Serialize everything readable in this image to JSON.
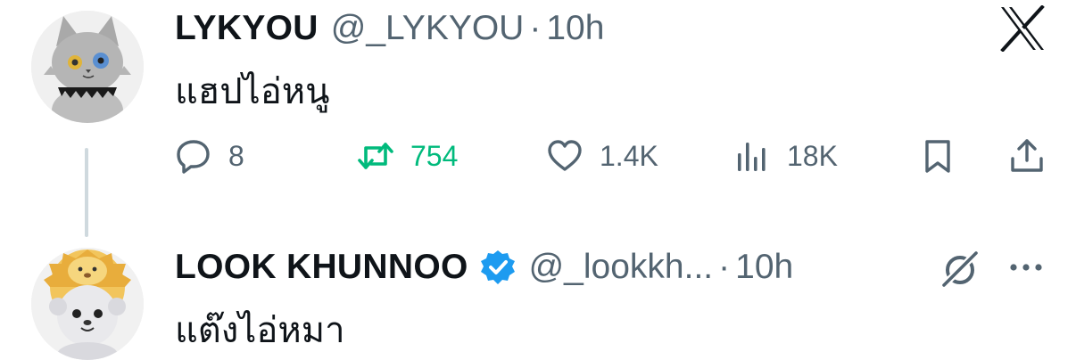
{
  "tweets": [
    {
      "display_name": "LYKYOU",
      "handle": "@_LYKYOU",
      "separator": "·",
      "time": "10h",
      "text": "แฮปไอ่หนู",
      "avatar_icon": "gray-cat-plush-avatar",
      "corner_icon": "x-logo-icon",
      "actions": {
        "replies": "8",
        "reposts": "754",
        "likes": "1.4K",
        "views": "18K"
      },
      "colors": {
        "repost_active": "#00ba7c"
      }
    },
    {
      "display_name": "LOOK KHUNNOO",
      "verified": true,
      "verified_color": "#1d9bf0",
      "handle": "@_lookkh...",
      "separator": "·",
      "time": "10h",
      "text": "แต๊งไอ่หมา",
      "avatar_icon": "lion-hood-plush-avatar",
      "grok-icon": "grok-icon",
      "more_icon": "more-icon"
    }
  ],
  "colors": {
    "text_primary": "#0f1419",
    "text_secondary": "#536471",
    "thread_line": "#cfd9de"
  }
}
